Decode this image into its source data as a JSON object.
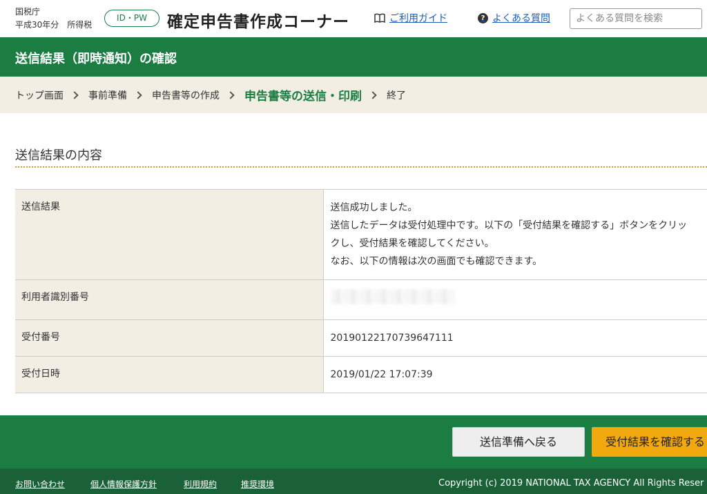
{
  "header": {
    "agency": "国税庁",
    "year_tax": "平成30年分　所得税",
    "id_pw_badge": "ID・PW",
    "site_title": "確定申告書作成コーナー",
    "guide_link": "ご利用ガイド",
    "faq_link": "よくある質問",
    "search_placeholder": "よくある質問を検索"
  },
  "page_title": "送信結果（即時通知）の確認",
  "breadcrumb": {
    "items": [
      "トップ画面",
      "事前準備",
      "申告書等の作成",
      "申告書等の送信・印刷",
      "終了"
    ],
    "current_index": 3
  },
  "section_title": "送信結果の内容",
  "table": {
    "rows": [
      {
        "label": "送信結果",
        "lines": [
          "送信成功しました。",
          "送信したデータは受付処理中です。以下の「受付結果を確認する」ボタンをクリッ",
          "クし、受付結果を確認してください。",
          "なお、以下の情報は次の画面でも確認できます。"
        ]
      },
      {
        "label": "利用者識別番号",
        "value": ""
      },
      {
        "label": "受付番号",
        "value": "20190122170739647111"
      },
      {
        "label": "受付日時",
        "value": "2019/01/22 17:07:39"
      }
    ]
  },
  "actions": {
    "back_label": "送信準備へ戻る",
    "confirm_label": "受付結果を確認する"
  },
  "footer": {
    "links": [
      "お問い合わせ",
      "個人情報保護方針",
      "利用規約",
      "推奨環境"
    ],
    "copyright": "Copyright (c) 2019 NATIONAL TAX AGENCY All Rights Reser"
  },
  "colors": {
    "brand_green": "#1c7d43",
    "footer_green": "#1a6138",
    "accent_orange": "#f1a90f",
    "breadcrumb_bg": "#f2eee4",
    "link_blue": "#1a5fb4"
  },
  "icons": {
    "guide": "book-icon",
    "faq": "question-circle-icon",
    "breadcrumb_separator": "chevron-right-icon"
  }
}
